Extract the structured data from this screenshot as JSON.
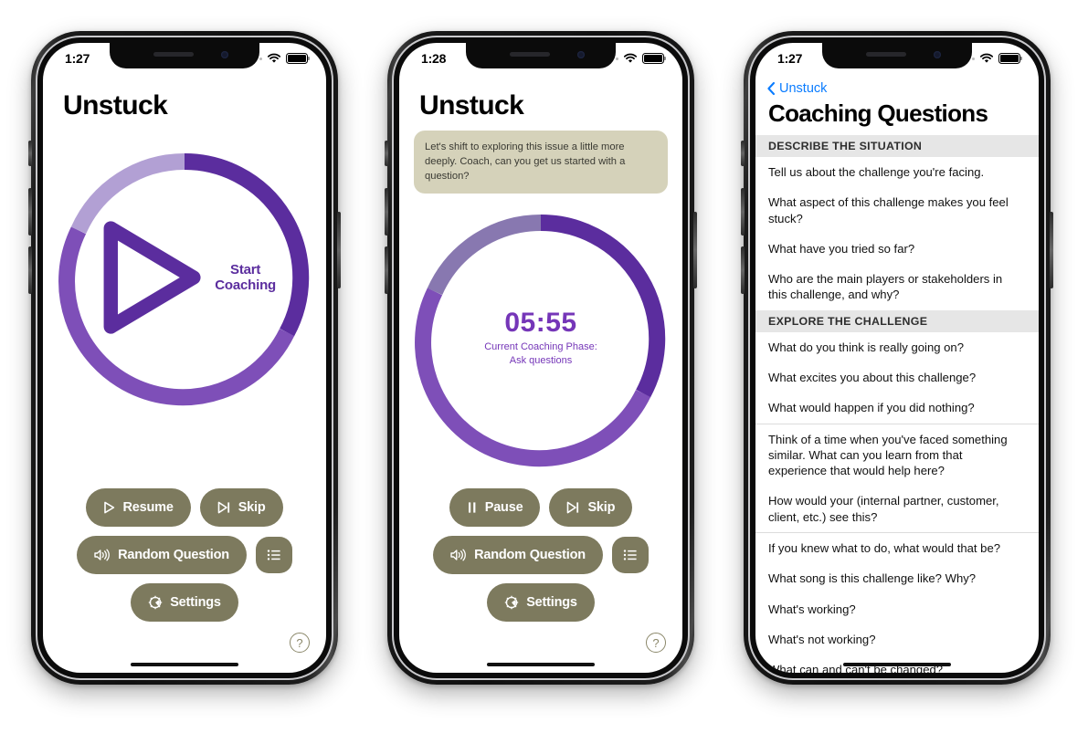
{
  "colors": {
    "olive_button": "#7d7a5e",
    "ring_dark_purple": "#5b2d9e",
    "ring_mid_purple": "#7e4fb8",
    "ring_light_purple": "#b2a0d4",
    "ring_muted_purple": "#8878b0",
    "bubble_bg": "#d5d2ba",
    "ios_blue": "#0a7cff",
    "section_header_bg": "#e6e6e6",
    "timer_purple": "#7536b8"
  },
  "phone1": {
    "status": {
      "time": "1:27",
      "signal_icon": "signal-dots-icon",
      "wifi_icon": "wifi-icon",
      "battery_icon": "battery-icon"
    },
    "app_title": "Unstuck",
    "ring_center": {
      "play_icon": "play-icon",
      "label": "Start Coaching"
    },
    "controls": {
      "resume": {
        "label": "Resume",
        "icon": "play-icon"
      },
      "skip": {
        "label": "Skip",
        "icon": "skip-forward-icon"
      },
      "random_question": {
        "label": "Random Question",
        "icon": "speaker-wave-icon"
      },
      "list": {
        "label": "",
        "icon": "list-bullet-icon"
      },
      "settings": {
        "label": "Settings",
        "icon": "gear-icon"
      }
    },
    "help": {
      "label": "?",
      "icon": "question-mark-circle-icon"
    }
  },
  "phone2": {
    "status": {
      "time": "1:28",
      "signal_icon": "signal-dots-icon",
      "wifi_icon": "wifi-icon",
      "battery_icon": "battery-icon"
    },
    "app_title": "Unstuck",
    "message": "Let's shift to exploring this issue a little more deeply.  Coach, can you get us started with a question?",
    "ring_center": {
      "timer": "05:55",
      "phase_label": "Current Coaching Phase:",
      "phase_value": "Ask questions"
    },
    "controls": {
      "pause": {
        "label": "Pause",
        "icon": "pause-icon"
      },
      "skip": {
        "label": "Skip",
        "icon": "skip-forward-icon"
      },
      "random_question": {
        "label": "Random Question",
        "icon": "speaker-wave-icon"
      },
      "list": {
        "label": "",
        "icon": "list-bullet-icon"
      },
      "settings": {
        "label": "Settings",
        "icon": "gear-icon"
      }
    },
    "help": {
      "label": "?",
      "icon": "question-mark-circle-icon"
    }
  },
  "phone3": {
    "status": {
      "time": "1:27",
      "signal_icon": "signal-dots-icon",
      "wifi_icon": "wifi-icon",
      "battery_icon": "battery-icon"
    },
    "back": {
      "label": "Unstuck",
      "icon": "chevron-left-icon"
    },
    "title": "Coaching Questions",
    "sections": [
      {
        "header": "DESCRIBE THE SITUATION",
        "items": [
          {
            "text": "Tell us about the challenge you're facing.",
            "divider": false
          },
          {
            "text": "What aspect of this challenge makes you feel stuck?",
            "divider": false
          },
          {
            "text": "What have you tried so far?",
            "divider": false
          },
          {
            "text": "Who are the main players or stakeholders in this challenge, and why?",
            "divider": false
          }
        ]
      },
      {
        "header": "EXPLORE THE CHALLENGE",
        "items": [
          {
            "text": "What do you think is really going on?",
            "divider": false
          },
          {
            "text": "What excites you about this challenge?",
            "divider": false
          },
          {
            "text": "What would happen if you did nothing?",
            "divider": false
          },
          {
            "text": "Think of a time when you've faced something similar. What can you learn from that experience that would help here?",
            "divider": true
          },
          {
            "text": "How would your (internal partner, customer, client, etc.) see this?",
            "divider": false
          },
          {
            "text": "If you knew what to do, what would that be?",
            "divider": true
          },
          {
            "text": "What song is this challenge like? Why?",
            "divider": false
          },
          {
            "text": "What's working?",
            "divider": false
          },
          {
            "text": "What's not working?",
            "divider": false
          },
          {
            "text": "What can and can't be changed?",
            "divider": false
          }
        ]
      }
    ]
  }
}
